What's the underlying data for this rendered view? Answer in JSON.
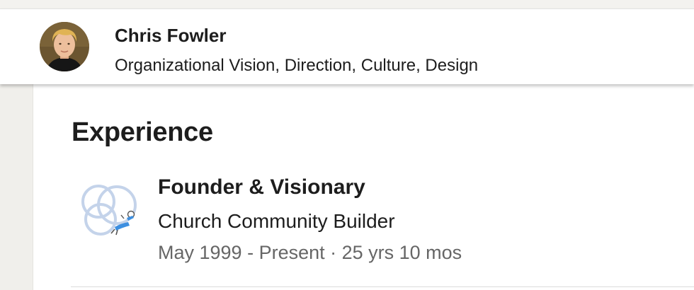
{
  "profile": {
    "name": "Chris Fowler",
    "headline": "Organizational Vision, Direction, Culture, Design",
    "avatar_icon": "profile-photo"
  },
  "experience": {
    "title": "Experience",
    "items": [
      {
        "title": "Founder & Visionary",
        "company": "Church Community Builder",
        "dates": "May 1999 - Present · 25 yrs 10 mos",
        "logo_icon": "church-community-builder-logo"
      }
    ]
  },
  "colors": {
    "text_primary": "#1d1d1d",
    "text_secondary": "#666666",
    "page_background": "#f3f2ef",
    "logo_circle": "#c4d3ea",
    "logo_figure": "#3d8fe0"
  }
}
